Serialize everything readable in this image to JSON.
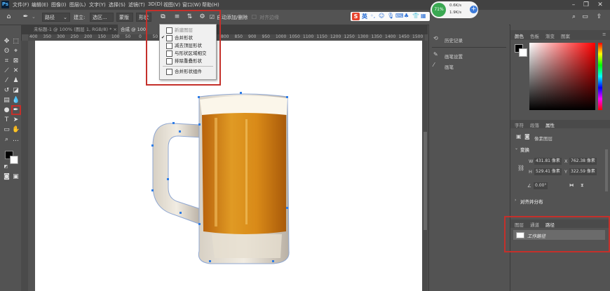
{
  "app": {
    "logo": "Ps"
  },
  "menubar": {
    "items": [
      "文件(F)",
      "编辑(E)",
      "图像(I)",
      "图层(L)",
      "文字(Y)",
      "选择(S)",
      "滤镜(T)",
      "3D(D)",
      "视图(V)",
      "窗口(W)",
      "帮助(H)"
    ]
  },
  "optbar": {
    "path_mode": "路径",
    "make_label": "建立:",
    "selection_btn": "选区...",
    "mask_btn": "蒙版",
    "shape_btn": "形状",
    "auto_add_delete": "自动添加/删除",
    "align_edges": "对齐边缘"
  },
  "ime": {
    "label": "英",
    "percent": "71%",
    "net_up": "0.6K/s",
    "net_down": "1.9K/s"
  },
  "tabs": [
    {
      "label": "未标题-1 @ 100% (图层 1, RGB/8) *",
      "close": "×",
      "active": false
    },
    {
      "label": "合成 @ 100",
      "active": true
    }
  ],
  "ruler": {
    "ticks": [
      "400",
      "350",
      "300",
      "250",
      "200",
      "150",
      "100",
      "50",
      "0",
      "50",
      "100",
      "650",
      "700",
      "750",
      "800",
      "850",
      "900",
      "950",
      "1000",
      "1050",
      "1100",
      "1150",
      "1200",
      "1250",
      "1300",
      "1350",
      "1400",
      "1450",
      "1500"
    ]
  },
  "dropdown": {
    "items": [
      {
        "label": "新建图层",
        "disabled": true,
        "checked": false
      },
      {
        "label": "合并形状",
        "disabled": false,
        "checked": true
      },
      {
        "label": "减去顶层形状",
        "disabled": false,
        "checked": false
      },
      {
        "label": "与形状区域相交",
        "disabled": false,
        "checked": false
      },
      {
        "label": "排除重叠形状",
        "disabled": false,
        "checked": false
      },
      {
        "label": "合并形状组件",
        "disabled": false,
        "checked": false
      }
    ]
  },
  "mid_panel": {
    "history": "历史记录",
    "brush_settings": "画笔设置",
    "brushes": "画笔"
  },
  "color_panel": {
    "tabs": [
      "颜色",
      "色板",
      "渐变",
      "图案"
    ],
    "hue_color": "#ff0000"
  },
  "properties_panel": {
    "tabs": [
      "字符",
      "段落",
      "属性"
    ],
    "layer_type": "像素图层",
    "transform_title": "变换",
    "w_label": "W",
    "w_value": "431.81 像素",
    "x_label": "X",
    "x_value": "762.38 像素",
    "h_label": "H",
    "h_value": "529.41 像素",
    "y_label": "Y",
    "y_value": "322.59 像素",
    "angle_value": "0.00°",
    "align_title": "对齐并分布"
  },
  "layers_panel": {
    "tabs": [
      "图层",
      "通道",
      "路径"
    ],
    "path_item": "工作路径"
  },
  "colors": {
    "highlight": "#c4302b",
    "canvas_bg": "#ffffff",
    "panel_bg": "#535353"
  }
}
